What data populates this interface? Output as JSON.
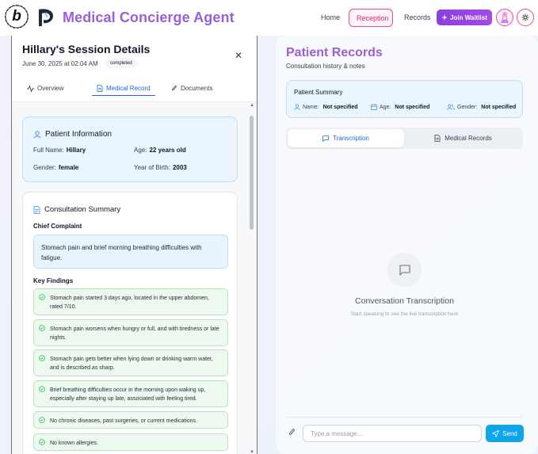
{
  "header": {
    "brand_seal_text": "POWERED BY BOLT",
    "app_title": "Medical Concierge Agent",
    "nav": {
      "home": "Home",
      "reception": "Reception",
      "records": "Records"
    },
    "join_label": "Join Waitlist"
  },
  "session": {
    "title": "Hillary's Session Details",
    "date": "June 30, 2025 at 02:04 AM",
    "status": "completed",
    "tabs": {
      "overview": "Overview",
      "medical_record": "Medical Record",
      "documents": "Documents"
    }
  },
  "patient_info": {
    "heading": "Patient Information",
    "full_name_label": "Full Name:",
    "full_name": "Hillary",
    "age_label": "Age:",
    "age": "22 years old",
    "gender_label": "Gender:",
    "gender": "female",
    "yob_label": "Year of Birth:",
    "yob": "2003"
  },
  "consultation": {
    "heading": "Consultation Summary",
    "chief_label": "Chief Complaint",
    "chief_text": "Stomach pain and brief morning breathing difficulties with fatigue.",
    "findings_label": "Key Findings",
    "findings": [
      "Stomach pain started 3 days ago, located in the upper abdomen, rated 7/10.",
      "Stomach pain worsens when hungry or full, and with tiredness or late nights.",
      "Stomach pain gets better when lying down or drinking warm water, and is described as sharp.",
      "Brief breathing difficulties occur in the morning upon waking up, especially after staying up late, associated with feeling tired.",
      "No chronic diseases, past surgeries, or current medications.",
      "No known allergies."
    ]
  },
  "records": {
    "title": "Patient Records",
    "subtitle": "Consultation history & notes",
    "summary_heading": "Patient Summary",
    "name_label": "Name:",
    "name_value": "Not specified",
    "age_label": "Age:",
    "age_value": "Not specified",
    "gender_label": "Gender:",
    "gender_value": "Not specified",
    "seg_transcription": "Transcription",
    "seg_medical": "Medical Records",
    "empty_title": "Conversation Transcription",
    "empty_sub": "Start speaking to see the live transcription here",
    "input_placeholder": "Type a message...",
    "send_label": "Send"
  },
  "colors": {
    "brand_purple": "#9b5fd6",
    "reception_pink": "#ec4899",
    "join_purple": "#8b3fe0",
    "link_blue": "#2563eb",
    "send_blue": "#0ea5e9",
    "finding_green": "#22c55e"
  }
}
